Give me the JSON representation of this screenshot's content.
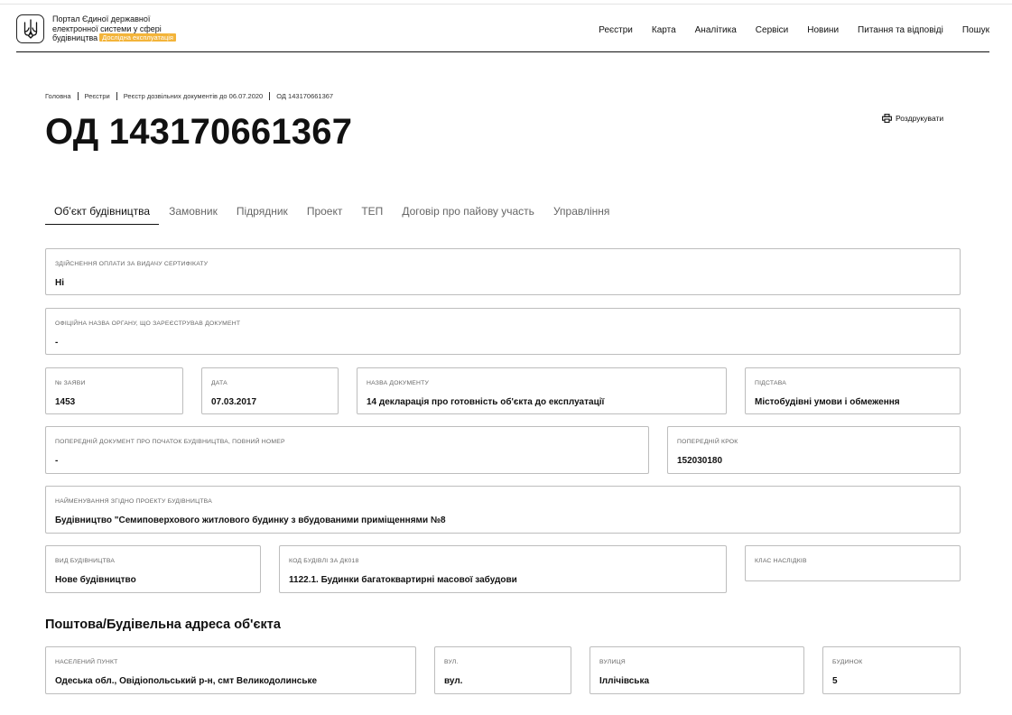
{
  "header": {
    "brand_lines": [
      "Портал Єдиної державної",
      "електронної системи у сфері",
      "будівництва"
    ],
    "badge": "Дослідна експлуатація",
    "nav": [
      "Реєстри",
      "Карта",
      "Аналітика",
      "Сервіси",
      "Новини",
      "Питання та відповіді",
      "Пошук"
    ]
  },
  "breadcrumb": [
    "Головна",
    "Реєстри",
    "Реєстр дозвільних документів до 06.07.2020",
    "ОД 143170661367"
  ],
  "page_title": "ОД 143170661367",
  "print_label": "Роздрукувати",
  "tabs": [
    "Об’єкт будівництва",
    "Замовник",
    "Підрядник",
    "Проект",
    "ТЕП",
    "Договір про пайову участь",
    "Управління"
  ],
  "active_tab": "Об’єкт будівництва",
  "fields": {
    "payment": {
      "label": "Здійснення оплати за видачу сертифікату",
      "value": "Ні"
    },
    "authority": {
      "label": "Офіційна назва органу, що зареєстрував документ",
      "value": "-"
    },
    "application_no": {
      "label": "№ заяви",
      "value": "1453"
    },
    "date": {
      "label": "Дата",
      "value": "07.03.2017"
    },
    "doc_name": {
      "label": "Назва документу",
      "value": "14 декларація про готовність об'єкта до експлуатації"
    },
    "basis": {
      "label": "Підстава",
      "value": "Містобудівні умови і обмеження"
    },
    "prev_doc": {
      "label": "Попередній документ про початок будівництва, повний номер",
      "value": "-"
    },
    "prev_step": {
      "label": "Попередній крок",
      "value": "152030180"
    },
    "project_name": {
      "label": "Найменування згідно проекту будівництва",
      "value": "Будівництво \"Семиповерхового житлового будинку з вбудованими приміщеннями №8"
    },
    "construction_type": {
      "label": "Вид будівництва",
      "value": "Нове будівництво"
    },
    "building_code": {
      "label": "Код будівлі за ДК018",
      "value": "1122.1. Будинки багатоквартирні масової забудови"
    },
    "consequence_class": {
      "label": "Клас наслідків",
      "value": ""
    }
  },
  "address_section_title": "Поштова/Будівельна адреса об'єкта",
  "address": {
    "locality": {
      "label": "Населений пункт",
      "value": "Одеська обл., Овідіопольський р-н, смт Великодолинське"
    },
    "street_type": {
      "label": "Вул.",
      "value": "вул."
    },
    "street": {
      "label": "Вулиця",
      "value": "Іллічівська"
    },
    "building": {
      "label": "Будинок",
      "value": "5"
    }
  },
  "colors": {
    "badge": "#f3b43a",
    "border": "#bdbdbd",
    "text": "#111111"
  },
  "icons": [
    "trident-icon",
    "printer-icon"
  ]
}
